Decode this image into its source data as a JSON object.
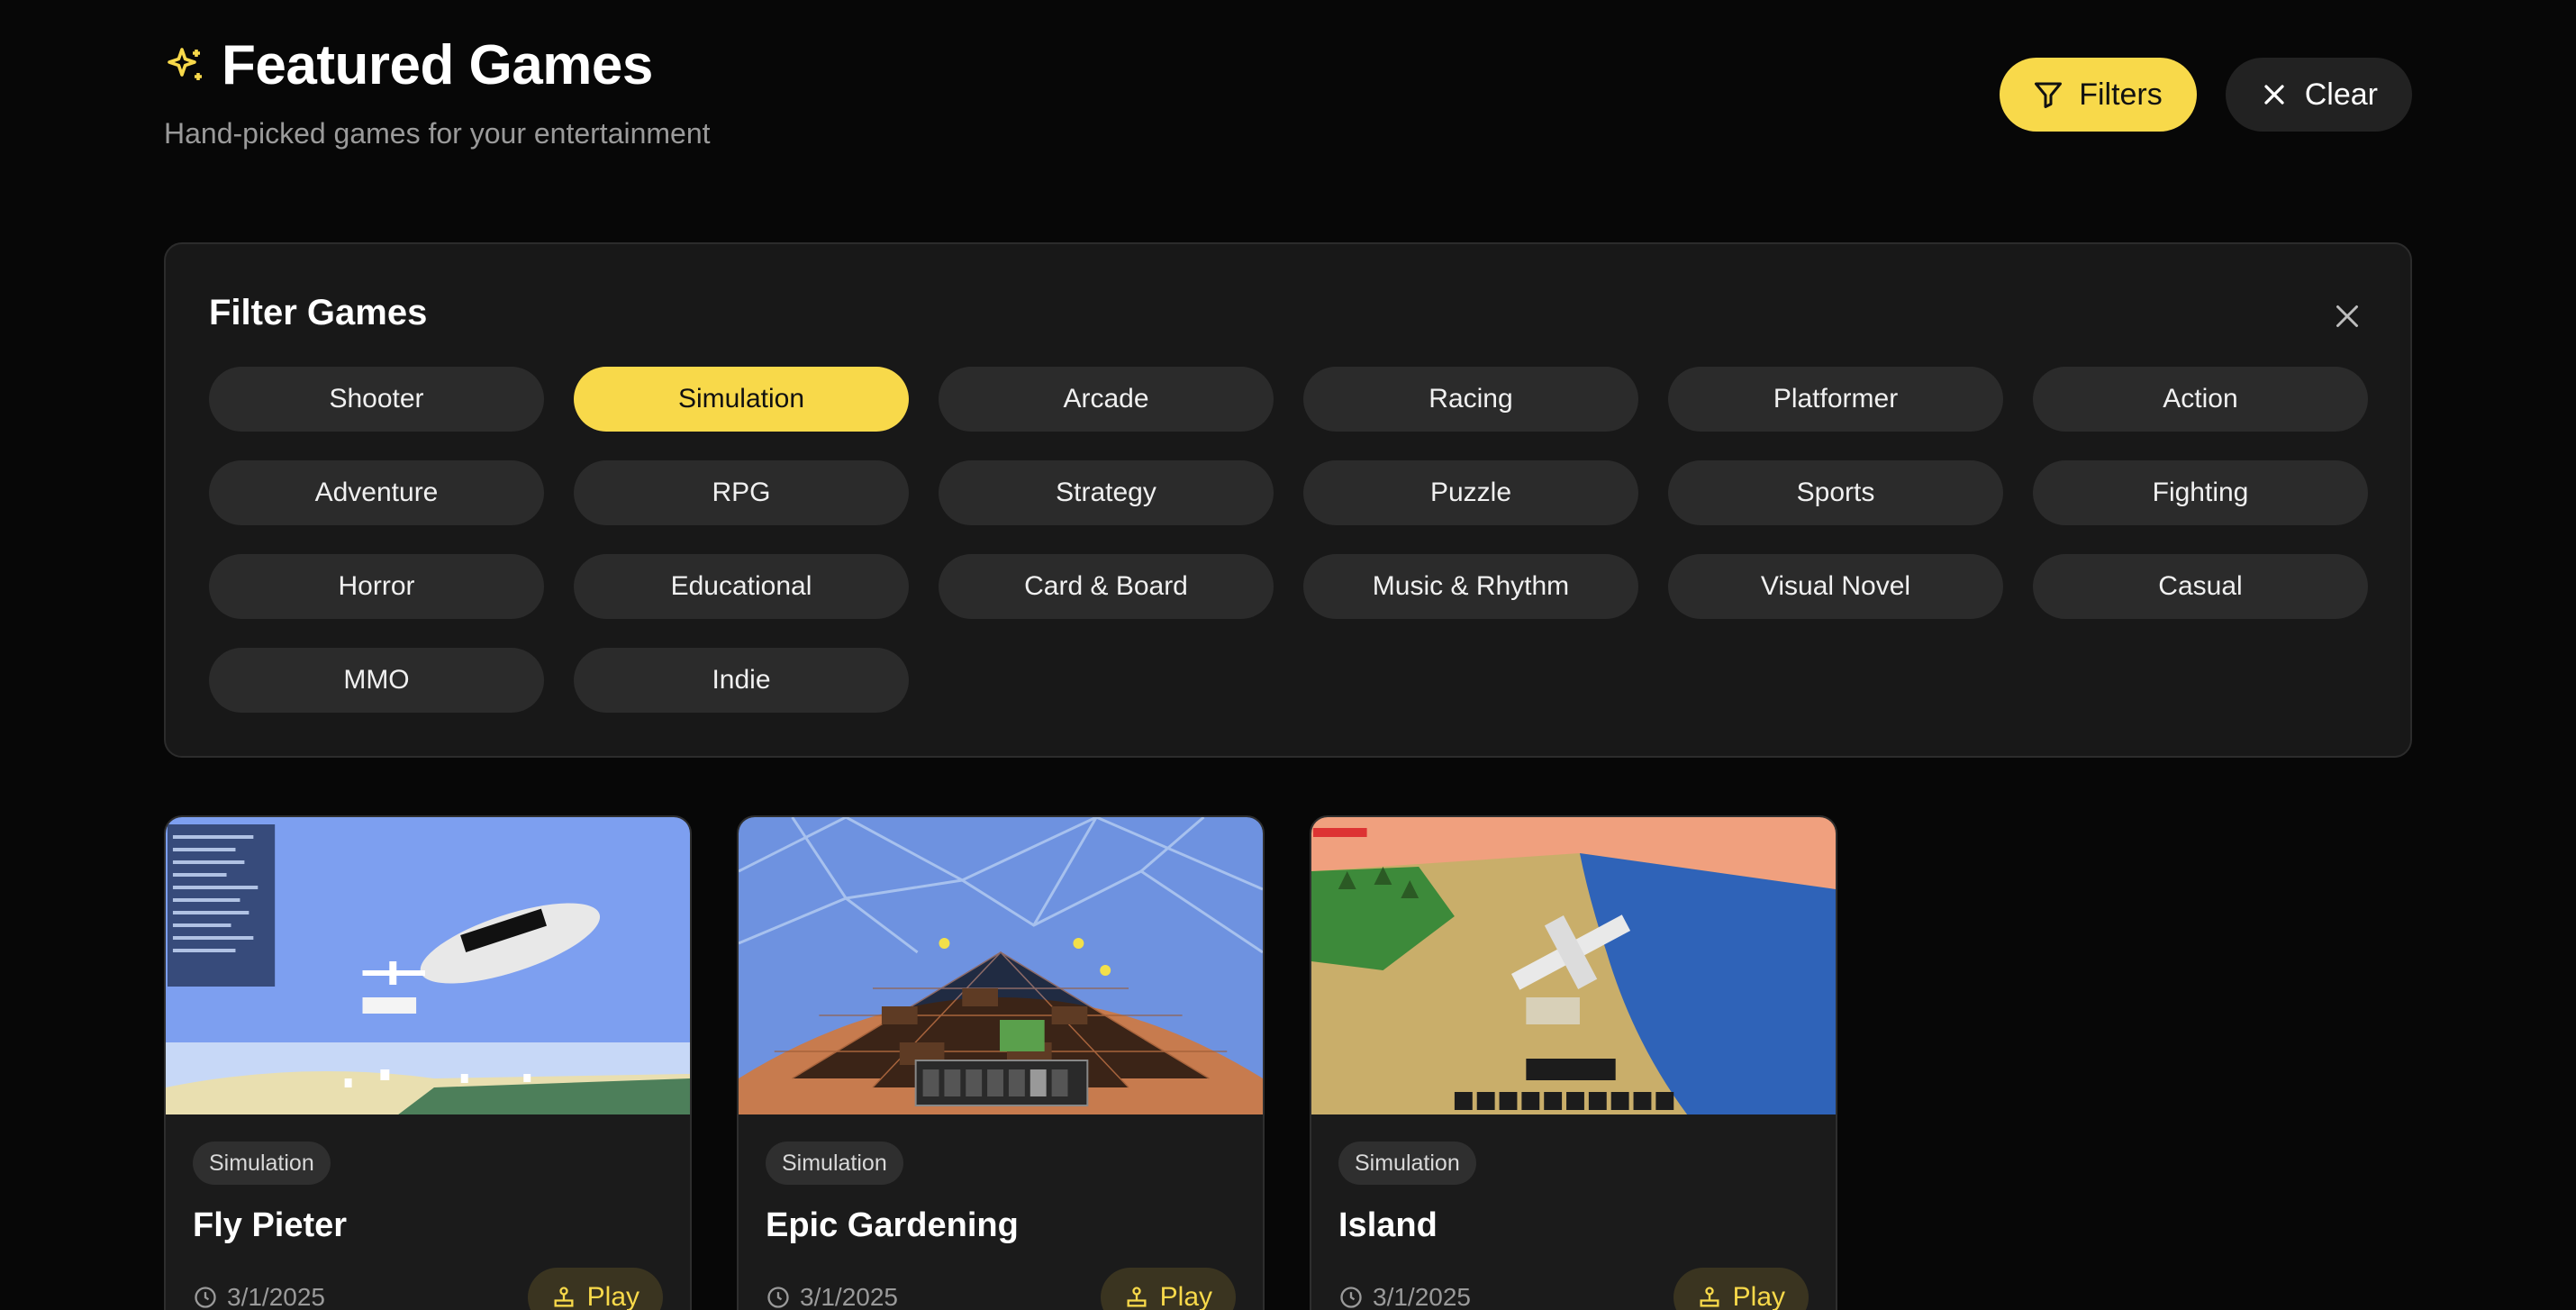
{
  "header": {
    "title": "Featured Games",
    "subtitle": "Hand-picked games for your entertainment",
    "filters_label": "Filters",
    "clear_label": "Clear"
  },
  "colors": {
    "accent": "#f8d94a",
    "background": "#070707",
    "panel": "#181818",
    "chip": "#2b2b2b"
  },
  "filter_panel": {
    "title": "Filter Games",
    "active": "Simulation",
    "categories": [
      "Shooter",
      "Simulation",
      "Arcade",
      "Racing",
      "Platformer",
      "Action",
      "Adventure",
      "RPG",
      "Strategy",
      "Puzzle",
      "Sports",
      "Fighting",
      "Horror",
      "Educational",
      "Card & Board",
      "Music & Rhythm",
      "Visual Novel",
      "Casual",
      "MMO",
      "Indie"
    ]
  },
  "games": [
    {
      "badge": "Simulation",
      "title": "Fly Pieter",
      "date": "3/1/2025",
      "play_label": "Play"
    },
    {
      "badge": "Simulation",
      "title": "Epic Gardening",
      "date": "3/1/2025",
      "play_label": "Play"
    },
    {
      "badge": "Simulation",
      "title": "Island",
      "date": "3/1/2025",
      "play_label": "Play"
    }
  ],
  "icons": {
    "title": "sparkles-icon",
    "filters": "filter-icon",
    "clear": "x-icon",
    "panel_close": "close-icon",
    "date": "clock-icon",
    "play": "joystick-icon"
  }
}
